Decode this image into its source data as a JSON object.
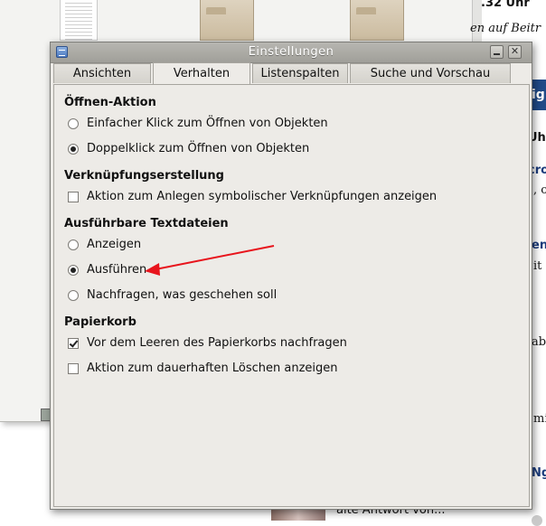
{
  "background": {
    "web_fragments": [
      ".32 Uhr",
      "en auf Beitr",
      "ig",
      "Uhr",
      "cro",
      ", od",
      "en",
      "it E",
      "abe",
      "mic",
      "Ng",
      "alte Antwort von..."
    ]
  },
  "window": {
    "title": "Einstellungen",
    "close_glyph": "✕"
  },
  "tabs": [
    {
      "label": "Ansichten",
      "active": false
    },
    {
      "label": "Verhalten",
      "active": true
    },
    {
      "label": "Listenspalten",
      "active": false
    },
    {
      "label": "Suche und Vorschau",
      "active": false
    }
  ],
  "sections": {
    "open_action": {
      "heading": "Öffnen-Aktion",
      "options": [
        {
          "label": "Einfacher Klick zum Öffnen von Objekten",
          "checked": false
        },
        {
          "label": "Doppelklick zum Öffnen von Objekten",
          "checked": true
        }
      ]
    },
    "link_creation": {
      "heading": "Verknüpfungserstellung",
      "options": [
        {
          "label": "Aktion zum Anlegen symbolischer Verknüpfungen anzeigen",
          "checked": false
        }
      ]
    },
    "executable_text": {
      "heading": "Ausführbare Textdateien",
      "options": [
        {
          "label": "Anzeigen",
          "checked": false
        },
        {
          "label": "Ausführen",
          "checked": true
        },
        {
          "label": "Nachfragen, was geschehen soll",
          "checked": false
        }
      ]
    },
    "trash": {
      "heading": "Papierkorb",
      "options": [
        {
          "label": "Vor dem Leeren des Papierkorbs nachfragen",
          "checked": true
        },
        {
          "label": "Aktion zum dauerhaften Löschen anzeigen",
          "checked": false
        }
      ]
    }
  },
  "colors": {
    "annotation_arrow": "#e8141c",
    "web_link_blue": "#1c3c7c"
  }
}
